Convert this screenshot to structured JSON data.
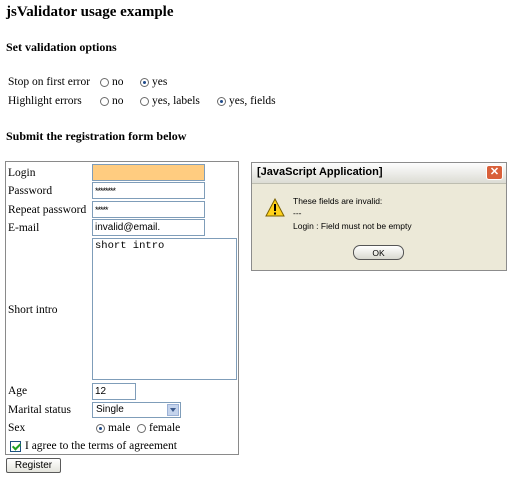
{
  "page": {
    "title": "jsValidator usage example",
    "options_heading": "Set validation options",
    "form_heading": "Submit the registration form below"
  },
  "options": {
    "stop_label": "Stop on first error",
    "stop_choices": [
      "no",
      "yes"
    ],
    "stop_selected": "yes",
    "highlight_label": "Highlight errors",
    "highlight_choices": [
      "no",
      "yes, labels",
      "yes, fields"
    ],
    "highlight_selected": "yes, fields"
  },
  "form": {
    "login_label": "Login",
    "login_value": "",
    "password_label": "Password",
    "password_value": "********",
    "repeat_label": "Repeat password",
    "repeat_value": "*****",
    "email_label": "E-mail",
    "email_value": "invalid@email.",
    "intro_label": "Short intro",
    "intro_value": "short intro",
    "age_label": "Age",
    "age_value": "12",
    "marital_label": "Marital status",
    "marital_value": "Single",
    "sex_label": "Sex",
    "sex_choices": [
      "male",
      "female"
    ],
    "sex_selected": "male",
    "agree_label": "I agree to the terms of agreement",
    "agree_checked": true,
    "register_label": "Register"
  },
  "dialog": {
    "title": "[JavaScript Application]",
    "close_glyph": "✕",
    "line1": "These fields are invalid:",
    "line2": "---",
    "line3": "Login : Field must not be empty",
    "ok_label": "OK"
  },
  "colors": {
    "highlight_field": "#ffcc80",
    "dialog_bg": "#ece9d8",
    "close_button": "#d9603a"
  }
}
